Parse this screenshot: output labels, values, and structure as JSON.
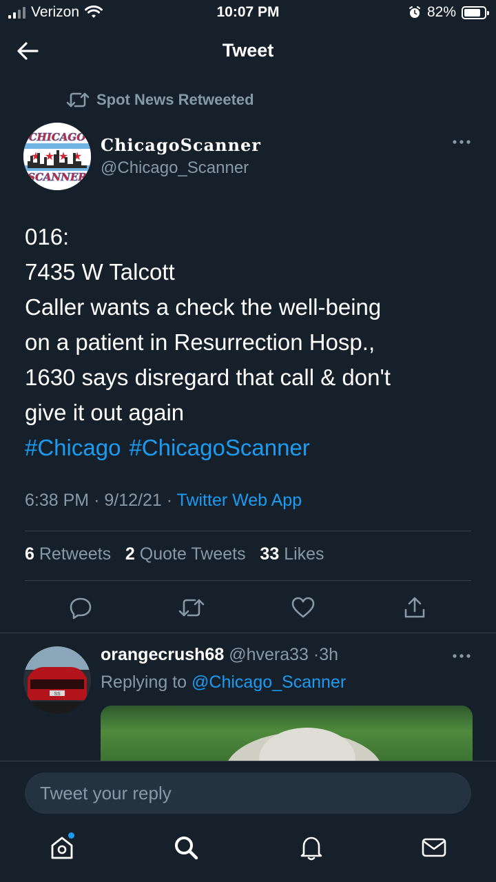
{
  "status_bar": {
    "carrier": "Verizon",
    "time": "10:07 PM",
    "battery_percent": "82%",
    "battery_level": 0.82
  },
  "header": {
    "title": "Tweet"
  },
  "retweet_context": {
    "text": "Spot News Retweeted"
  },
  "tweet": {
    "display_name": "ChicagoScanner",
    "handle": "@Chicago_Scanner",
    "avatar_text_top": "CHICAGO",
    "avatar_text_bottom": "SCANNER",
    "lines": [
      "016:",
      "7435 W Talcott",
      "Caller wants a check the well-being",
      "on a patient in Resurrection Hosp.,",
      "1630 says disregard that call & don't",
      "give it out again"
    ],
    "hashtags": [
      "#Chicago",
      "#ChicagoScanner"
    ],
    "time": "6:38 PM",
    "date": "9/12/21",
    "source": "Twitter Web App",
    "retweets_count": "6",
    "retweets_label": "Retweets",
    "quotes_count": "2",
    "quotes_label": "Quote Tweets",
    "likes_count": "33",
    "likes_label": "Likes"
  },
  "reply": {
    "display_name": "orangecrush68",
    "handle": "@hvera33",
    "age": "3h",
    "replying_prefix": "Replying to",
    "replying_mention": "@Chicago_Scanner",
    "plate_text": "SS"
  },
  "composer": {
    "placeholder": "Tweet your reply"
  },
  "colors": {
    "background": "#15202b",
    "accent": "#1d9bf0",
    "muted": "#8899a6",
    "divider": "#38444d"
  },
  "icons": {
    "back": "arrow-left-icon",
    "retweet": "retweet-icon",
    "more": "more-horizontal-icon",
    "reply": "reply-icon",
    "like": "heart-icon",
    "share": "share-icon",
    "home": "home-icon",
    "search": "search-icon",
    "notifications": "bell-icon",
    "messages": "mail-icon"
  }
}
